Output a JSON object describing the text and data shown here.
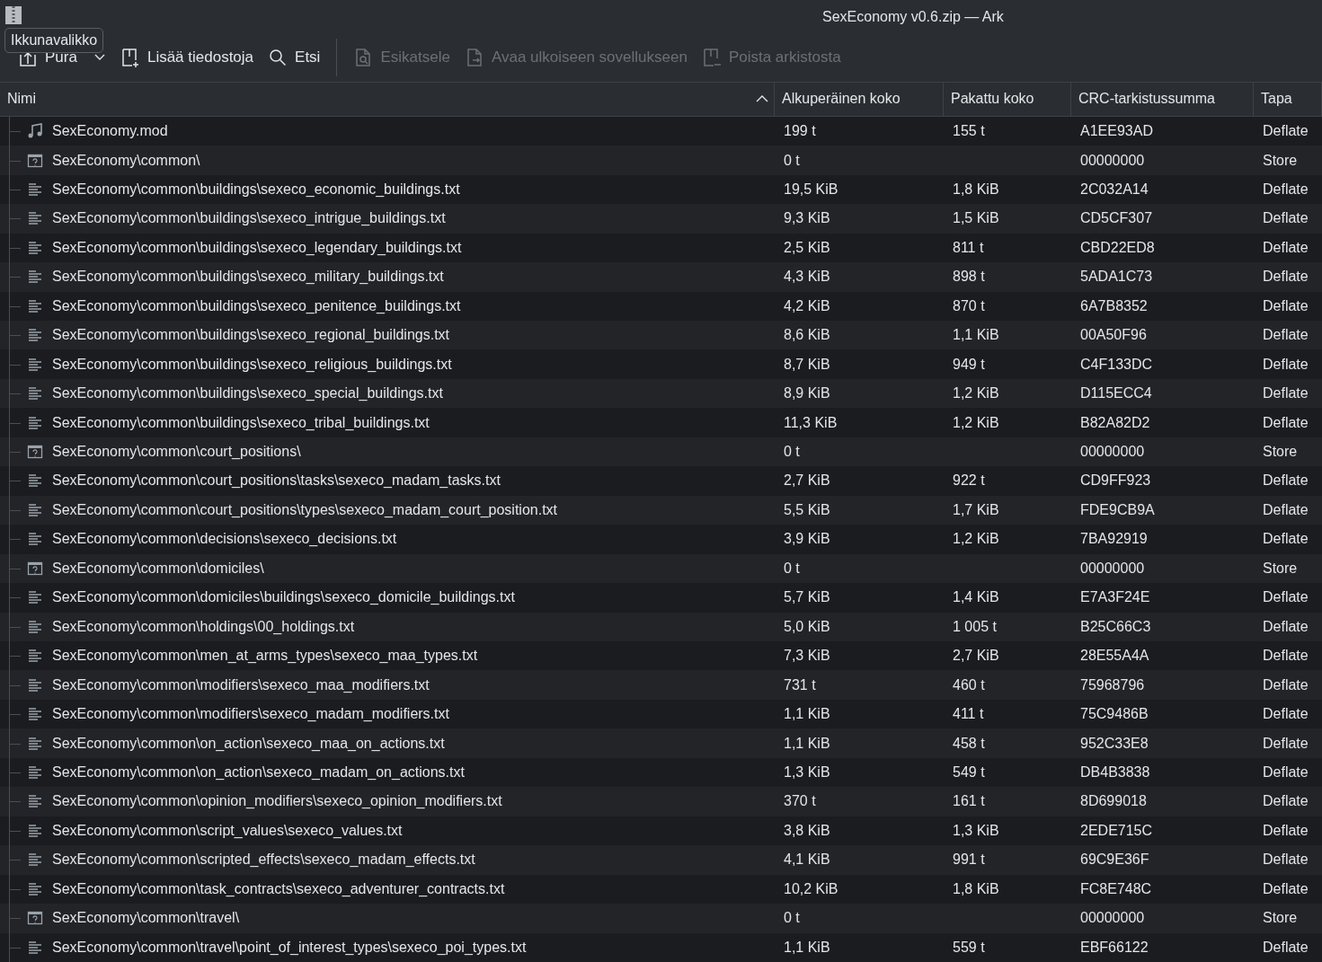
{
  "window": {
    "title": "SexEconomy v0.6.zip — Ark",
    "tooltip": "Ikkunavalikko"
  },
  "toolbar": [
    {
      "label": "Pura",
      "kind": "extract",
      "disabled": false,
      "dropdown": true
    },
    {
      "label": "Lisää tiedostoja",
      "kind": "add",
      "disabled": false,
      "dropdown": false
    },
    {
      "label": "Etsi",
      "kind": "search",
      "disabled": false,
      "dropdown": false
    },
    {
      "label": "Esikatsele",
      "kind": "preview",
      "disabled": true,
      "dropdown": false
    },
    {
      "label": "Avaa ulkoiseen sovellukseen",
      "kind": "open",
      "disabled": true,
      "dropdown": false
    },
    {
      "label": "Poista arkistosta",
      "kind": "delete",
      "disabled": true,
      "dropdown": false
    }
  ],
  "table": {
    "columns": [
      {
        "label": "Nimi",
        "sorted": true
      },
      {
        "label": "Alkuperäinen koko",
        "sorted": false
      },
      {
        "label": "Pakattu koko",
        "sorted": false
      },
      {
        "label": "CRC-tarkistussumma",
        "sorted": false
      },
      {
        "label": "Tapa",
        "sorted": false
      }
    ],
    "rows": [
      {
        "kind": "audio",
        "cells": [
          "SexEconomy.mod",
          "199 t",
          "155 t",
          "A1EE93AD",
          "Deflate"
        ]
      },
      {
        "kind": "folder",
        "cells": [
          "SexEconomy\\common\\",
          "0 t",
          "",
          "00000000",
          "Store"
        ]
      },
      {
        "kind": "text",
        "cells": [
          "SexEconomy\\common\\buildings\\sexeco_economic_buildings.txt",
          "19,5 KiB",
          "1,8 KiB",
          "2C032A14",
          "Deflate"
        ]
      },
      {
        "kind": "text",
        "cells": [
          "SexEconomy\\common\\buildings\\sexeco_intrigue_buildings.txt",
          "9,3 KiB",
          "1,5 KiB",
          "CD5CF307",
          "Deflate"
        ]
      },
      {
        "kind": "text",
        "cells": [
          "SexEconomy\\common\\buildings\\sexeco_legendary_buildings.txt",
          "2,5 KiB",
          "811 t",
          "CBD22ED8",
          "Deflate"
        ]
      },
      {
        "kind": "text",
        "cells": [
          "SexEconomy\\common\\buildings\\sexeco_military_buildings.txt",
          "4,3 KiB",
          "898 t",
          "5ADA1C73",
          "Deflate"
        ]
      },
      {
        "kind": "text",
        "cells": [
          "SexEconomy\\common\\buildings\\sexeco_penitence_buildings.txt",
          "4,2 KiB",
          "870 t",
          "6A7B8352",
          "Deflate"
        ]
      },
      {
        "kind": "text",
        "cells": [
          "SexEconomy\\common\\buildings\\sexeco_regional_buildings.txt",
          "8,6 KiB",
          "1,1 KiB",
          "00A50F96",
          "Deflate"
        ]
      },
      {
        "kind": "text",
        "cells": [
          "SexEconomy\\common\\buildings\\sexeco_religious_buildings.txt",
          "8,7 KiB",
          "949 t",
          "C4F133DC",
          "Deflate"
        ]
      },
      {
        "kind": "text",
        "cells": [
          "SexEconomy\\common\\buildings\\sexeco_special_buildings.txt",
          "8,9 KiB",
          "1,2 KiB",
          "D115ECC4",
          "Deflate"
        ]
      },
      {
        "kind": "text",
        "cells": [
          "SexEconomy\\common\\buildings\\sexeco_tribal_buildings.txt",
          "11,3 KiB",
          "1,2 KiB",
          "B82A82D2",
          "Deflate"
        ]
      },
      {
        "kind": "folder",
        "cells": [
          "SexEconomy\\common\\court_positions\\",
          "0 t",
          "",
          "00000000",
          "Store"
        ]
      },
      {
        "kind": "text",
        "cells": [
          "SexEconomy\\common\\court_positions\\tasks\\sexeco_madam_tasks.txt",
          "2,7 KiB",
          "922 t",
          "CD9FF923",
          "Deflate"
        ]
      },
      {
        "kind": "text",
        "cells": [
          "SexEconomy\\common\\court_positions\\types\\sexeco_madam_court_position.txt",
          "5,5 KiB",
          "1,7 KiB",
          "FDE9CB9A",
          "Deflate"
        ]
      },
      {
        "kind": "text",
        "cells": [
          "SexEconomy\\common\\decisions\\sexeco_decisions.txt",
          "3,9 KiB",
          "1,2 KiB",
          "7BA92919",
          "Deflate"
        ]
      },
      {
        "kind": "folder",
        "cells": [
          "SexEconomy\\common\\domiciles\\",
          "0 t",
          "",
          "00000000",
          "Store"
        ]
      },
      {
        "kind": "text",
        "cells": [
          "SexEconomy\\common\\domiciles\\buildings\\sexeco_domicile_buildings.txt",
          "5,7 KiB",
          "1,4 KiB",
          "E7A3F24E",
          "Deflate"
        ]
      },
      {
        "kind": "text",
        "cells": [
          "SexEconomy\\common\\holdings\\00_holdings.txt",
          "5,0 KiB",
          "1 005 t",
          "B25C66C3",
          "Deflate"
        ]
      },
      {
        "kind": "text",
        "cells": [
          "SexEconomy\\common\\men_at_arms_types\\sexeco_maa_types.txt",
          "7,3 KiB",
          "2,7 KiB",
          "28E55A4A",
          "Deflate"
        ]
      },
      {
        "kind": "text",
        "cells": [
          "SexEconomy\\common\\modifiers\\sexeco_maa_modifiers.txt",
          "731 t",
          "460 t",
          "75968796",
          "Deflate"
        ]
      },
      {
        "kind": "text",
        "cells": [
          "SexEconomy\\common\\modifiers\\sexeco_madam_modifiers.txt",
          "1,1 KiB",
          "411 t",
          "75C9486B",
          "Deflate"
        ]
      },
      {
        "kind": "text",
        "cells": [
          "SexEconomy\\common\\on_action\\sexeco_maa_on_actions.txt",
          "1,1 KiB",
          "458 t",
          "952C33E8",
          "Deflate"
        ]
      },
      {
        "kind": "text",
        "cells": [
          "SexEconomy\\common\\on_action\\sexeco_madam_on_actions.txt",
          "1,3 KiB",
          "549 t",
          "DB4B3838",
          "Deflate"
        ]
      },
      {
        "kind": "text",
        "cells": [
          "SexEconomy\\common\\opinion_modifiers\\sexeco_opinion_modifiers.txt",
          "370 t",
          "161 t",
          "8D699018",
          "Deflate"
        ]
      },
      {
        "kind": "text",
        "cells": [
          "SexEconomy\\common\\script_values\\sexeco_values.txt",
          "3,8 KiB",
          "1,3 KiB",
          "2EDE715C",
          "Deflate"
        ]
      },
      {
        "kind": "text",
        "cells": [
          "SexEconomy\\common\\scripted_effects\\sexeco_madam_effects.txt",
          "4,1 KiB",
          "991 t",
          "69C9E36F",
          "Deflate"
        ]
      },
      {
        "kind": "text",
        "cells": [
          "SexEconomy\\common\\task_contracts\\sexeco_adventurer_contracts.txt",
          "10,2 KiB",
          "1,8 KiB",
          "FC8E748C",
          "Deflate"
        ]
      },
      {
        "kind": "folder",
        "cells": [
          "SexEconomy\\common\\travel\\",
          "0 t",
          "",
          "00000000",
          "Store"
        ]
      },
      {
        "kind": "text",
        "cells": [
          "SexEconomy\\common\\travel\\point_of_interest_types\\sexeco_poi_types.txt",
          "1,1 KiB",
          "559 t",
          "EBF66122",
          "Deflate"
        ]
      }
    ]
  }
}
